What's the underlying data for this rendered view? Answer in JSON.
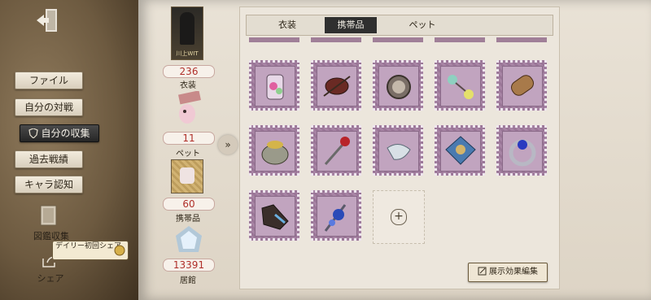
{
  "sidebar": {
    "items": [
      {
        "label": "ファイル"
      },
      {
        "label": "自分の対戦"
      },
      {
        "label": "自分の収集"
      },
      {
        "label": "過去戦績"
      },
      {
        "label": "キャラ認知"
      }
    ],
    "collection_label": "図鑑収集",
    "share_label": "シェア",
    "daily_share_tip": "デイリー初回シェア",
    "icons": {
      "exit": "exit-door-icon",
      "shield": "shield-icon",
      "book": "book-icon",
      "share": "share-icon",
      "coin": "coin-icon"
    }
  },
  "stats": [
    {
      "count": "236",
      "label": "衣装",
      "thumb_caption": "川上WIT"
    },
    {
      "count": "11",
      "label": "ペット"
    },
    {
      "count": "60",
      "label": "携帯品"
    },
    {
      "count": "13391",
      "label": "居館"
    }
  ],
  "tabs": [
    {
      "label": "衣装"
    },
    {
      "label": "携帯品"
    },
    {
      "label": "ペット"
    }
  ],
  "active_tab": "携帯品",
  "items": [
    {
      "name": "potion-bottle-icon"
    },
    {
      "name": "lantern-icon"
    },
    {
      "name": "pocket-watch-icon"
    },
    {
      "name": "glasses-icon"
    },
    {
      "name": "scroll-icon"
    },
    {
      "name": "pufferfish-icon"
    },
    {
      "name": "rose-cane-icon"
    },
    {
      "name": "tea-cup-icon"
    },
    {
      "name": "umbrella-icon"
    },
    {
      "name": "ring-icon"
    },
    {
      "name": "shoe-icon"
    },
    {
      "name": "flower-wand-icon"
    }
  ],
  "edit_button": {
    "label": "展示効果編集"
  },
  "colors": {
    "accent_red": "#b0302a",
    "stamp_purple": "#a784a4",
    "active_dark": "#2f2f2f"
  }
}
